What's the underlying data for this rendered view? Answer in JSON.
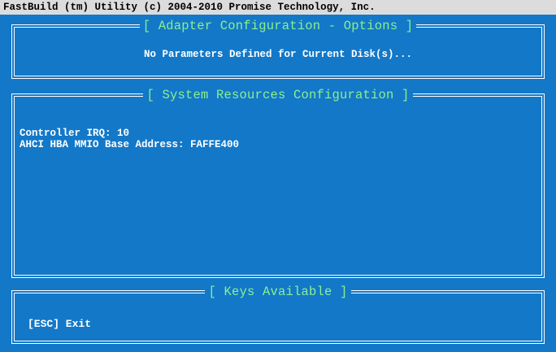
{
  "window": {
    "title": "FastBuild (tm) Utility (c) 2004-2010 Promise Technology, Inc."
  },
  "adapter_options": {
    "title": "[ Adapter Configuration - Options ]",
    "message": "No Parameters Defined for Current Disk(s)..."
  },
  "system_resources": {
    "title": "[ System Resources Configuration ]",
    "lines": [
      "Controller IRQ: 10",
      "AHCI HBA MMIO Base Address: FAFFE400"
    ]
  },
  "keys": {
    "title": "[ Keys Available ]",
    "esc": "[ESC] Exit"
  },
  "colors": {
    "background": "#1378c8",
    "title_text": "#8cf08c",
    "body_text": "#ffffff",
    "title_bar": "#dcdcdc"
  }
}
